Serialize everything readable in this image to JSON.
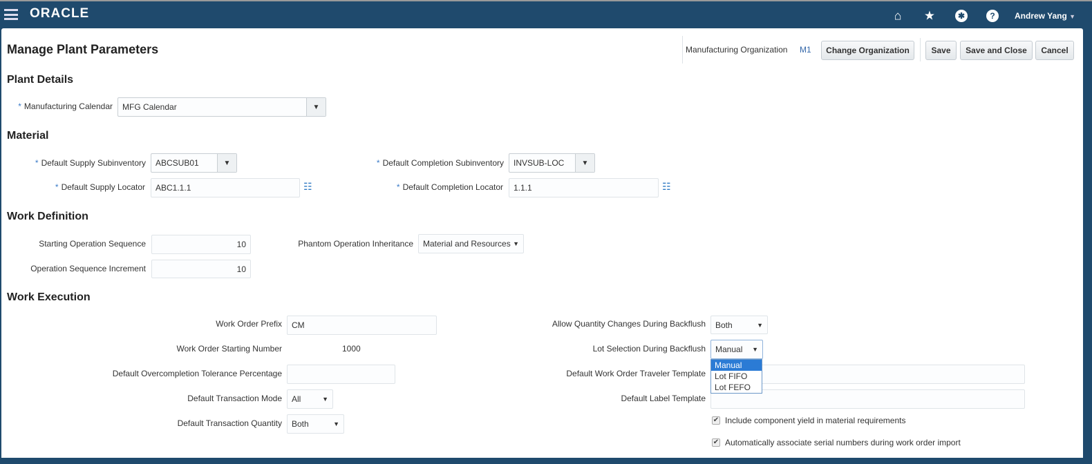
{
  "header": {
    "logo": "ORACLE",
    "user": "Andrew Yang",
    "icons": [
      "menu-icon",
      "home-icon",
      "star-icon",
      "accessibility-icon",
      "help-icon"
    ]
  },
  "page": {
    "title": "Manage Plant Parameters",
    "org_label": "Manufacturing Organization",
    "org_value": "M1",
    "change_org": "Change Organization",
    "save": "Save",
    "save_close": "Save and Close",
    "cancel": "Cancel"
  },
  "plant": {
    "heading": "Plant Details",
    "calendar_label": "Manufacturing Calendar",
    "calendar_value": "MFG Calendar"
  },
  "material": {
    "heading": "Material",
    "supply_sub_label": "Default Supply Subinventory",
    "supply_sub_value": "ABCSUB01",
    "comp_sub_label": "Default Completion Subinventory",
    "comp_sub_value": "INVSUB-LOC",
    "supply_loc_label": "Default Supply Locator",
    "supply_loc_value": "ABC1.1.1",
    "comp_loc_label": "Default Completion Locator",
    "comp_loc_value": "1.1.1"
  },
  "workdef": {
    "heading": "Work Definition",
    "start_seq_label": "Starting Operation Sequence",
    "start_seq_value": "10",
    "incr_label": "Operation Sequence Increment",
    "incr_value": "10",
    "phantom_label": "Phantom Operation Inheritance",
    "phantom_value": "Material and Resources"
  },
  "workexec": {
    "heading": "Work Execution",
    "prefix_label": "Work Order Prefix",
    "prefix_value": "CM",
    "start_num_label": "Work Order Starting Number",
    "start_num_value": "1000",
    "overcomp_label": "Default Overcompletion Tolerance Percentage",
    "overcomp_value": "",
    "txn_mode_label": "Default Transaction Mode",
    "txn_mode_value": "All",
    "txn_qty_label": "Default Transaction Quantity",
    "txn_qty_value": "Both",
    "allow_qty_label": "Allow Quantity Changes During Backflush",
    "allow_qty_value": "Both",
    "lot_sel_label": "Lot Selection During Backflush",
    "lot_sel_value": "Manual",
    "lot_options": [
      "Manual",
      "Lot FIFO",
      "Lot FEFO"
    ],
    "traveler_label": "Default Work Order Traveler Template",
    "traveler_value": "",
    "label_tmpl_label": "Default Label Template",
    "label_tmpl_value": "",
    "chk1": "Include component yield in material requirements",
    "chk2": "Automatically associate serial numbers during work order import"
  }
}
